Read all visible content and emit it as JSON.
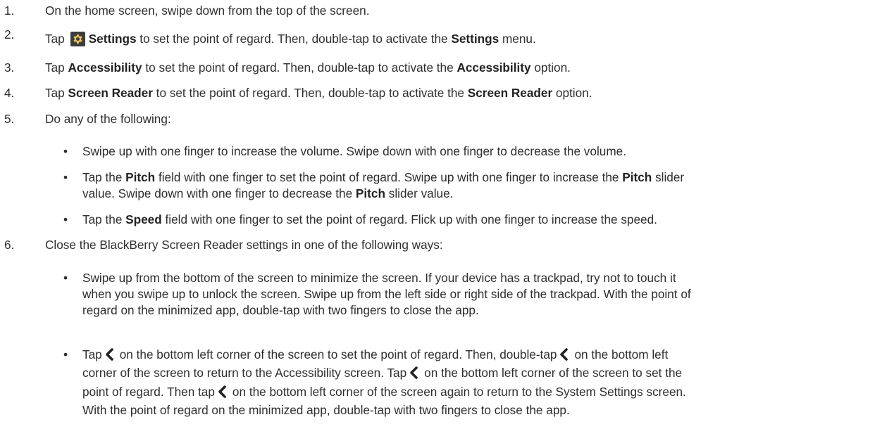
{
  "steps": [
    {
      "num": "1.",
      "parts": [
        {
          "t": "On the home screen, swipe down from the top of the screen."
        }
      ]
    },
    {
      "num": "2.",
      "parts": [
        {
          "t": "Tap"
        },
        {
          "icon": "gear-icon"
        },
        {
          "t": "Settings",
          "b": true
        },
        {
          "t": " to set the point of regard. Then, double-tap to activate the "
        },
        {
          "t": "Settings",
          "b": true
        },
        {
          "t": " menu."
        }
      ]
    },
    {
      "num": "3.",
      "parts": [
        {
          "t": "Tap "
        },
        {
          "t": "Accessibility",
          "b": true
        },
        {
          "t": " to set the point of regard. Then, double-tap to activate the "
        },
        {
          "t": "Accessibility",
          "b": true
        },
        {
          "t": " option."
        }
      ]
    },
    {
      "num": "4.",
      "parts": [
        {
          "t": "Tap "
        },
        {
          "t": "Screen Reader",
          "b": true
        },
        {
          "t": " to set the point of regard. Then, double-tap to activate the "
        },
        {
          "t": "Screen Reader",
          "b": true
        },
        {
          "t": " option."
        }
      ]
    },
    {
      "num": "5.",
      "parts": [
        {
          "t": "Do any of the following:"
        }
      ],
      "bullets": [
        [
          {
            "t": "Swipe up with one finger to increase the volume. Swipe down with one finger to decrease the volume."
          }
        ],
        [
          {
            "t": "Tap the "
          },
          {
            "t": "Pitch",
            "b": true
          },
          {
            "t": " field with one finger to set the point of regard. Swipe up with one finger to increase the "
          },
          {
            "t": "Pitch",
            "b": true
          },
          {
            "t": " slider"
          },
          {
            "br": true
          },
          {
            "t": "value. Swipe down with one finger to decrease the "
          },
          {
            "t": "Pitch",
            "b": true
          },
          {
            "t": " slider value."
          }
        ],
        [
          {
            "t": "Tap the "
          },
          {
            "t": "Speed",
            "b": true
          },
          {
            "t": " field with one finger to set the point of regard. Flick up with one finger to increase the speed."
          }
        ]
      ]
    },
    {
      "num": "6.",
      "parts": [
        {
          "t": "Close the BlackBerry Screen Reader settings in one of the following ways:"
        }
      ],
      "bullets": [
        [
          {
            "t": "Swipe up from the bottom of the screen to minimize the screen. If your device has a trackpad, try not to touch it"
          },
          {
            "br": true
          },
          {
            "t": "when you swipe up to unlock the screen. Swipe up from the left side or right side of the trackpad. With the point of"
          },
          {
            "br": true
          },
          {
            "t": "regard on the minimized app, double-tap with two fingers to close the app."
          }
        ],
        [
          {
            "t": "Tap"
          },
          {
            "icon": "back-chevron-icon"
          },
          {
            "t": "on the bottom left corner of the screen to set the point of regard. Then, double-tap"
          },
          {
            "icon": "back-chevron-icon"
          },
          {
            "t": "on the bottom left"
          },
          {
            "br": true
          },
          {
            "t": "corner of the screen to return to the Accessibility screen. Tap"
          },
          {
            "icon": "back-chevron-icon"
          },
          {
            "t": "on the bottom left corner of the screen to set the"
          },
          {
            "br": true
          },
          {
            "t": "point of regard. Then tap"
          },
          {
            "icon": "back-chevron-icon"
          },
          {
            "t": "on the bottom left corner of the screen again to return to the System Settings screen."
          },
          {
            "br": true
          },
          {
            "t": "With the point of regard on the minimized app, double-tap with two fingers to close the app."
          }
        ]
      ]
    }
  ],
  "bullet_symbol": "•",
  "colors": {
    "text": "#2e2e2e",
    "icon_bg": "#3d3d3d"
  }
}
